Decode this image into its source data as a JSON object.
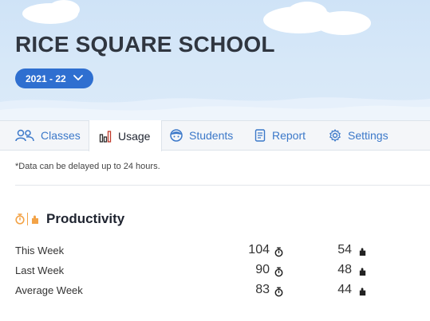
{
  "header": {
    "school_name": "RICE SQUARE SCHOOL",
    "year": "2021 - 22"
  },
  "tabs": [
    {
      "label": "Classes",
      "icon": "people-icon",
      "active": false
    },
    {
      "label": "Usage",
      "icon": "bar-chart-icon",
      "active": true
    },
    {
      "label": "Students",
      "icon": "student-face-icon",
      "active": false
    },
    {
      "label": "Report",
      "icon": "report-icon",
      "active": false
    },
    {
      "label": "Settings",
      "icon": "gear-icon",
      "active": false
    }
  ],
  "note": "*Data can be delayed up to 24 hours.",
  "productivity": {
    "title": "Productivity",
    "rows": [
      {
        "label": "This Week",
        "time": "104",
        "blocks": "54"
      },
      {
        "label": "Last Week",
        "time": "90",
        "blocks": "48"
      },
      {
        "label": "Average Week",
        "time": "83",
        "blocks": "44"
      }
    ]
  },
  "colors": {
    "accent": "#2f6fd0",
    "tab_link": "#3b78c9",
    "productivity_icon": "#f3a347"
  }
}
